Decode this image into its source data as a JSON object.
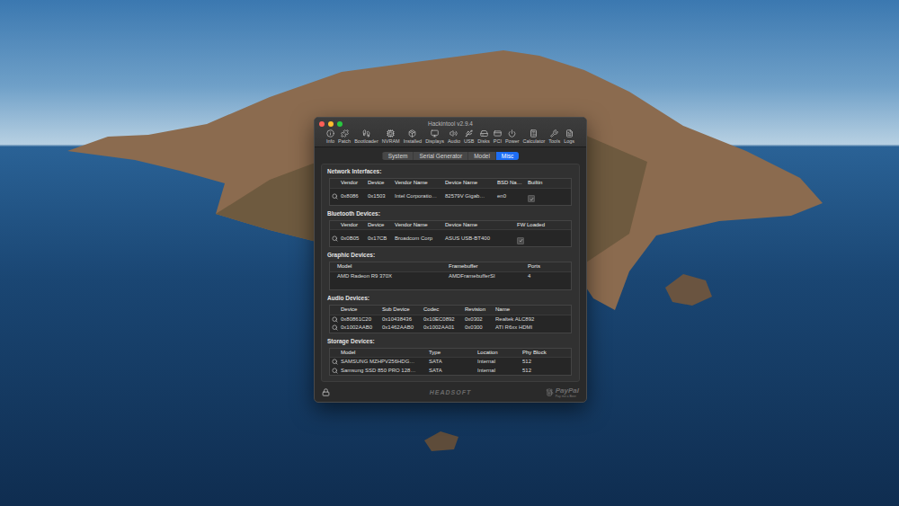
{
  "window": {
    "title": "Hackintool v2.9.4"
  },
  "toolbar": [
    "Info",
    "Patch",
    "Bootloader",
    "NVRAM",
    "Installed",
    "Displays",
    "Audio",
    "USB",
    "Disks",
    "PCI",
    "Power",
    "Calculator",
    "Tools",
    "Logs"
  ],
  "tabs": [
    {
      "label": "System",
      "selected": false
    },
    {
      "label": "Serial Generator",
      "selected": false
    },
    {
      "label": "Model",
      "selected": false
    },
    {
      "label": "Misc",
      "selected": true
    }
  ],
  "sections": {
    "network": {
      "title": "Network Interfaces:",
      "columns": [
        "Vendor",
        "Device",
        "Vendor Name",
        "Device Name",
        "BSD Na…",
        "Builtin"
      ],
      "rows": [
        {
          "cells": [
            "0x8086",
            "0x1503",
            "Intel Corporatio…",
            "82579V Gigab…",
            "en0",
            {
              "checked": true
            }
          ]
        }
      ]
    },
    "bluetooth": {
      "title": "Bluetooth Devices:",
      "columns": [
        "Vendor",
        "Device",
        "Vendor Name",
        "Device Name",
        "FW Loaded"
      ],
      "rows": [
        {
          "cells": [
            "0x0B05",
            "0x17CB",
            "Broadcom Corp",
            "ASUS USB-BT400",
            {
              "checked": true
            }
          ]
        }
      ]
    },
    "graphics": {
      "title": "Graphic Devices:",
      "columns": [
        "Model",
        "Framebuffer",
        "Ports"
      ],
      "rows": [
        {
          "cells": [
            "AMD Radeon R9 370X",
            "AMDFramebufferSI",
            "4"
          ]
        }
      ]
    },
    "audio": {
      "title": "Audio Devices:",
      "columns": [
        "Device",
        "Sub Device",
        "Codec",
        "Revision",
        "Name"
      ],
      "rows": [
        {
          "cells": [
            "0x80861C20",
            "0x10438436",
            "0x10EC0892",
            "0x0302",
            "Realtek ALC892"
          ]
        },
        {
          "cells": [
            "0x1002AAB0",
            "0x1462AAB0",
            "0x1002AA01",
            "0x0300",
            "ATI R6xx HDMI"
          ]
        }
      ]
    },
    "storage": {
      "title": "Storage Devices:",
      "columns": [
        "Model",
        "Type",
        "Location",
        "Phy Block"
      ],
      "rows": [
        {
          "cells": [
            "SAMSUNG MZHPV256HDG…",
            "SATA",
            "Internal",
            "512"
          ]
        },
        {
          "cells": [
            "Samsung SSD 850 PRO 128…",
            "SATA",
            "Internal",
            "512"
          ]
        }
      ]
    }
  },
  "footer": {
    "brand": "HEADSOFT",
    "donate": {
      "name": "PayPal",
      "tagline": "Pay me a Beer"
    }
  }
}
